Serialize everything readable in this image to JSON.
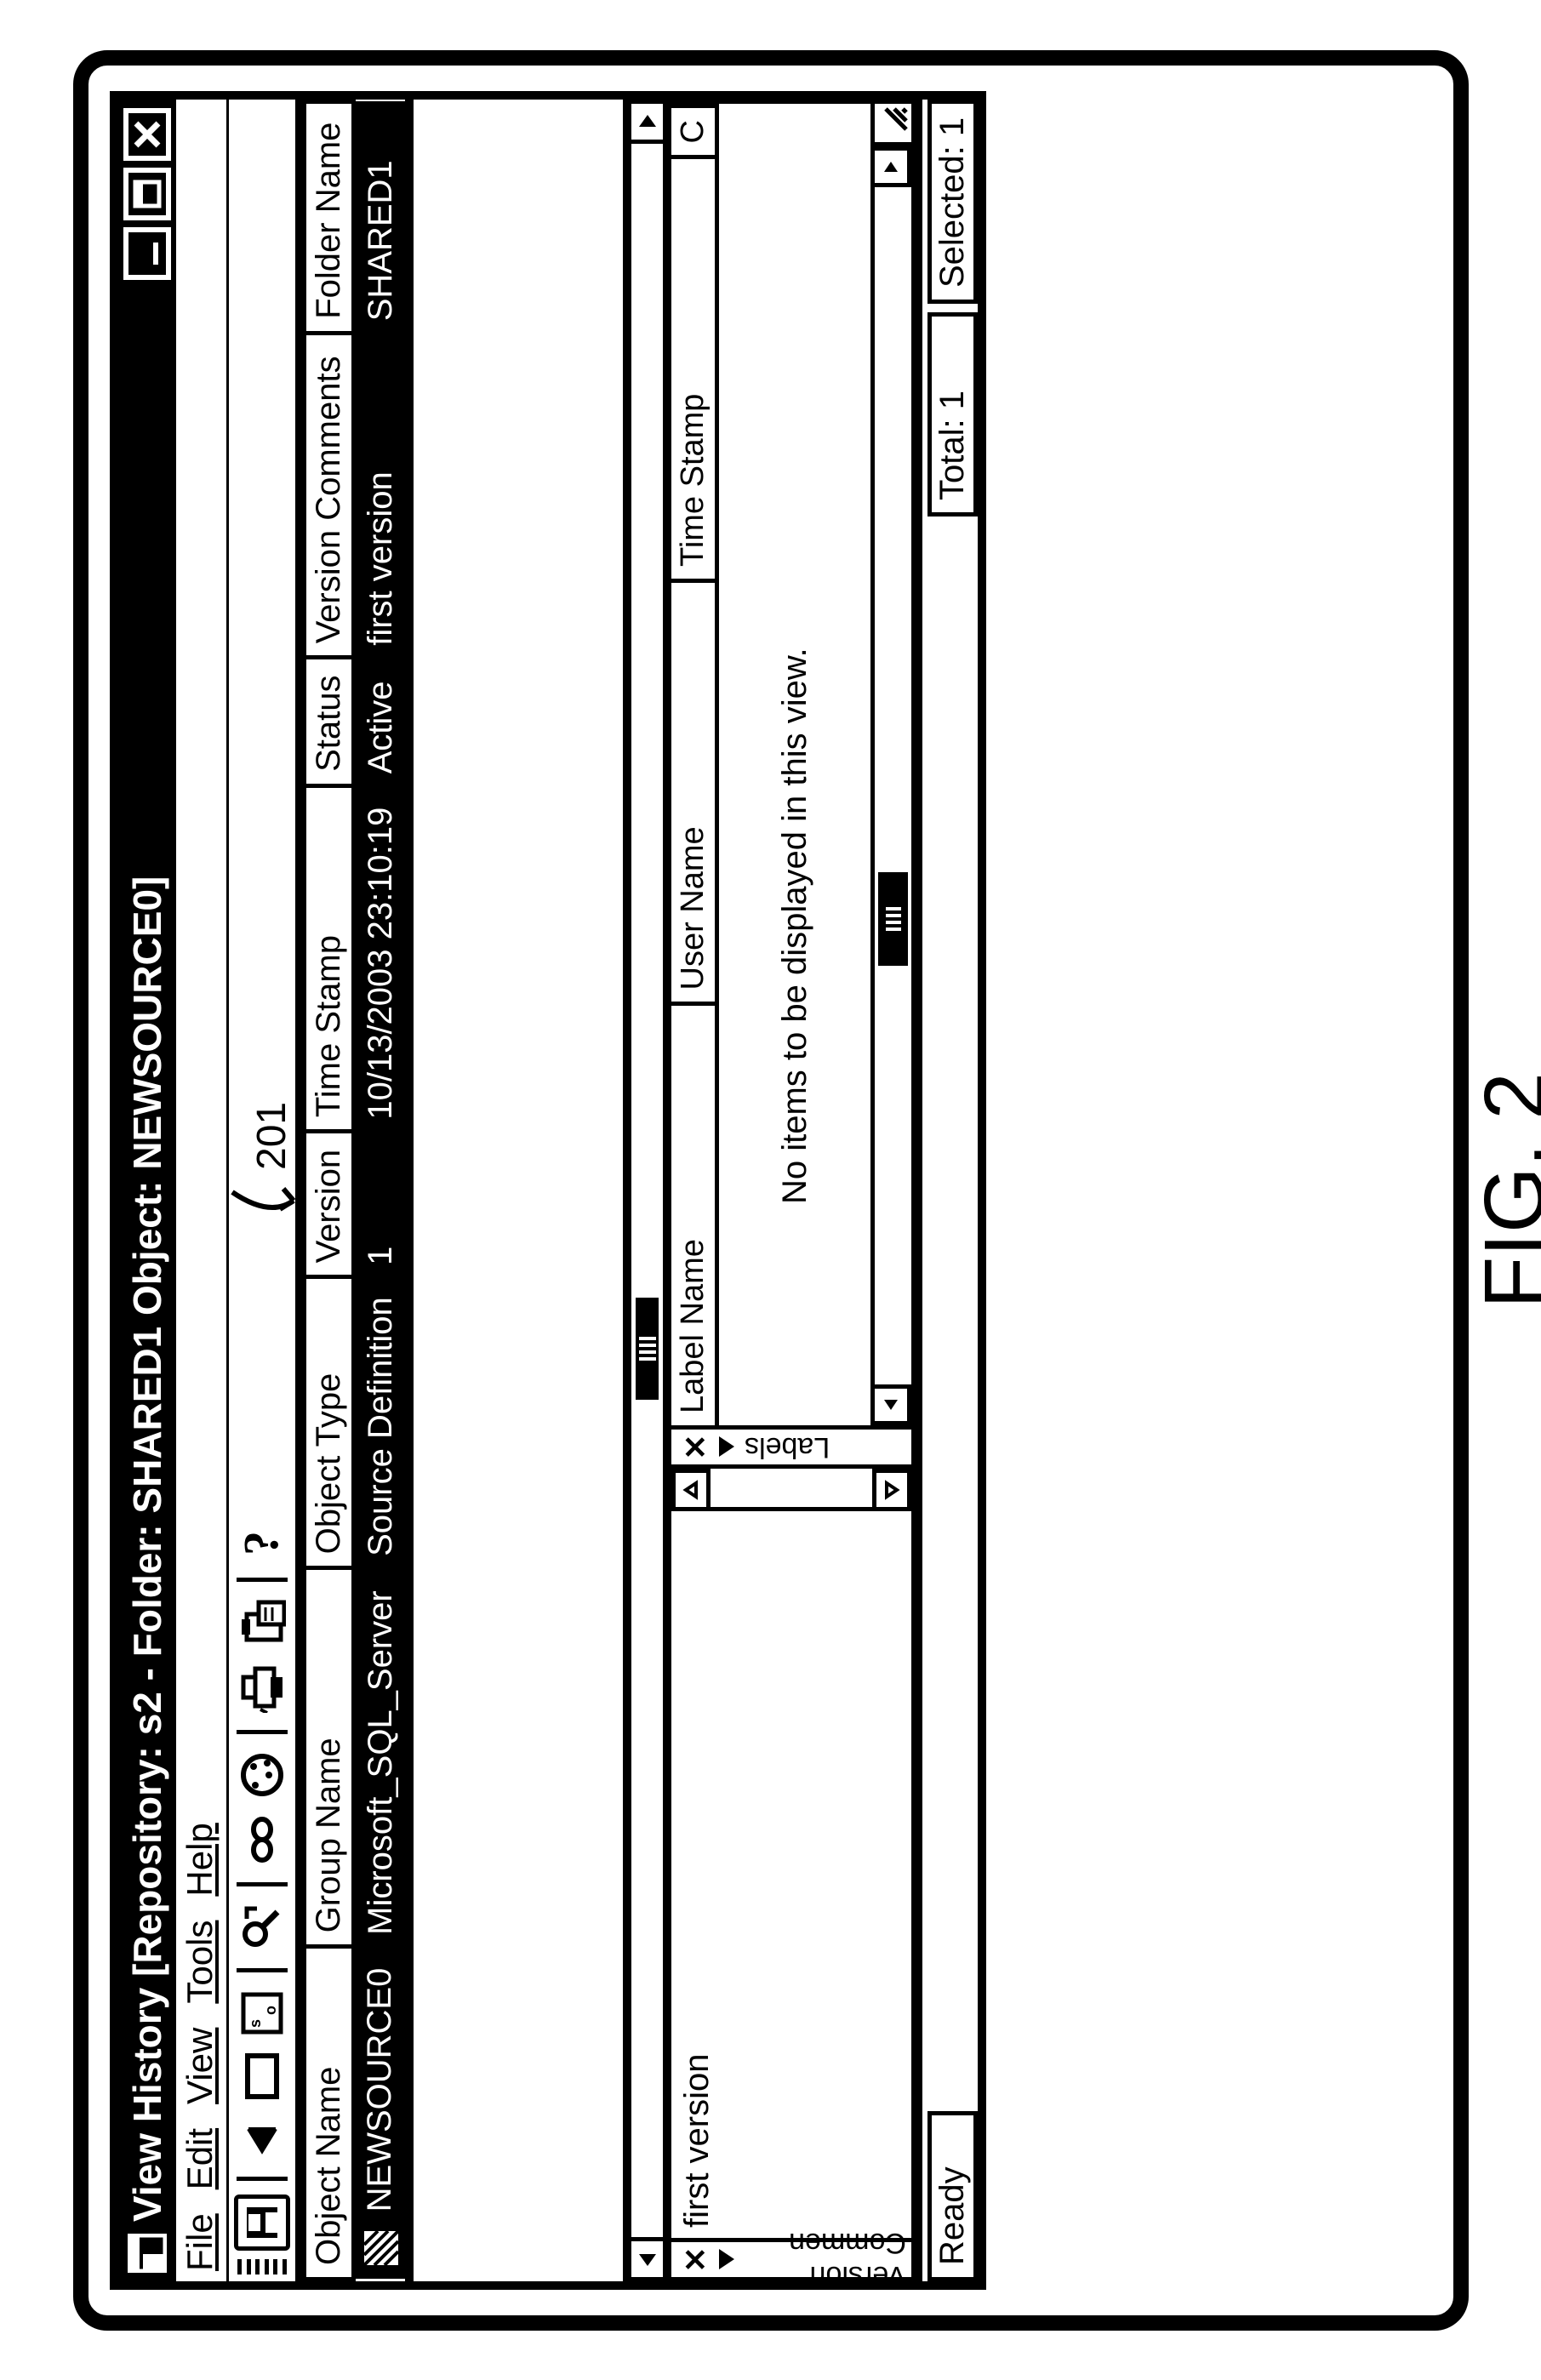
{
  "figure_caption": "FIG. 2",
  "callout_ref": "201",
  "window": {
    "title": "View History [Repository: s2 - Folder: SHARED1 Object: NEWSOURCE0]"
  },
  "menu": {
    "items": [
      "File",
      "Edit",
      "View",
      "Tools",
      "Help"
    ]
  },
  "toolbar": {
    "icons": [
      "save-icon",
      "back-icon",
      "panel-icon",
      "text-icon",
      "search-icon",
      "link-icon",
      "globe-icon",
      "print-icon",
      "paste-icon",
      "help-icon"
    ]
  },
  "main_grid": {
    "columns": [
      "Object Name",
      "Group Name",
      "Object Type",
      "Version",
      "Time Stamp",
      "Status",
      "Version Comments",
      "Folder Name"
    ],
    "rows": [
      {
        "object_name": "NEWSOURCE0",
        "group_name": "Microsoft_SQL_Server",
        "object_type": "Source Definition",
        "version": "1",
        "time_stamp": "10/13/2003 23:10:19",
        "status": "Active",
        "version_comments": "first version",
        "folder_name": "SHARED1"
      }
    ]
  },
  "panel_comments": {
    "tab_label": "Version Commen",
    "text": "first version"
  },
  "panel_labels": {
    "tab_label": "Labels",
    "columns": [
      "Label Name",
      "User Name",
      "Time Stamp",
      "C"
    ],
    "empty_message": "No items to be displayed in this view."
  },
  "status": {
    "ready": "Ready",
    "total": "Total: 1",
    "selected": "Selected: 1"
  }
}
